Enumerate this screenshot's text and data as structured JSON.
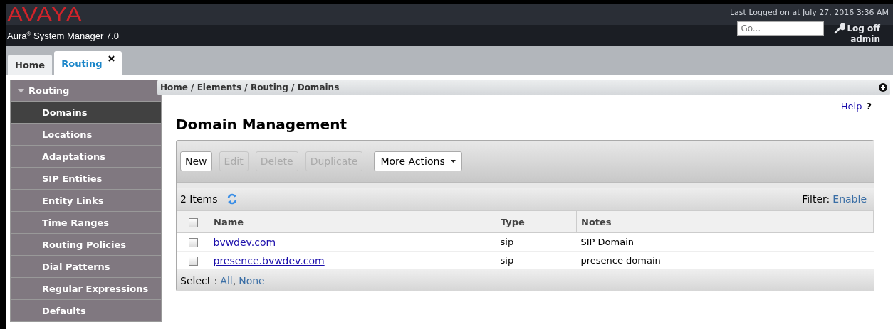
{
  "header": {
    "logo": "AVAYA",
    "product": "Aura$^{®}$ System Manager 7.0",
    "last_login": "Last Logged on at July 27, 2016 3:36 AM",
    "search": {
      "placeholder": "Go..."
    },
    "logoff": "Log off",
    "user": "admin"
  },
  "tabs": [
    {
      "label": "Home",
      "selected": false,
      "closable": false
    },
    {
      "label": "Routing",
      "selected": true,
      "closable": true
    }
  ],
  "sidebar": {
    "title": "Routing",
    "expanded": true,
    "items": [
      {
        "label": "Domains",
        "selected": true
      },
      {
        "label": "Locations",
        "selected": false
      },
      {
        "label": "Adaptations",
        "selected": false
      },
      {
        "label": "SIP Entities",
        "selected": false
      },
      {
        "label": "Entity Links",
        "selected": false
      },
      {
        "label": "Time Ranges",
        "selected": false
      },
      {
        "label": "Routing Policies",
        "selected": false
      },
      {
        "label": "Dial Patterns",
        "selected": false
      },
      {
        "label": "Regular Expressions",
        "selected": false
      },
      {
        "label": "Defaults",
        "selected": false
      }
    ]
  },
  "breadcrumb": "Home / Elements / Routing / Domains",
  "help": {
    "label": "Help",
    "mark": "?"
  },
  "title": "Domain Management",
  "toolbar": {
    "buttons": [
      {
        "label": "New",
        "disabled": false
      },
      {
        "label": "Edit",
        "disabled": true
      },
      {
        "label": "Delete",
        "disabled": true
      },
      {
        "label": "Duplicate",
        "disabled": true
      }
    ],
    "more_actions": "More Actions"
  },
  "table": {
    "count": "2 Items",
    "filter_label": "Filter:",
    "filter_link": "Enable",
    "header_checked": false,
    "columns": [
      "Name",
      "Type",
      "Notes"
    ],
    "rows": [
      {
        "checked": false,
        "name": "bvwdev.com",
        "type": "sip",
        "notes": "SIP Domain"
      },
      {
        "checked": false,
        "name": "presence.bvwdev.com",
        "type": "sip",
        "notes": "presence domain"
      }
    ],
    "footer": {
      "label": "Select :",
      "links": [
        "All",
        "None"
      ],
      "separator": ","
    }
  }
}
